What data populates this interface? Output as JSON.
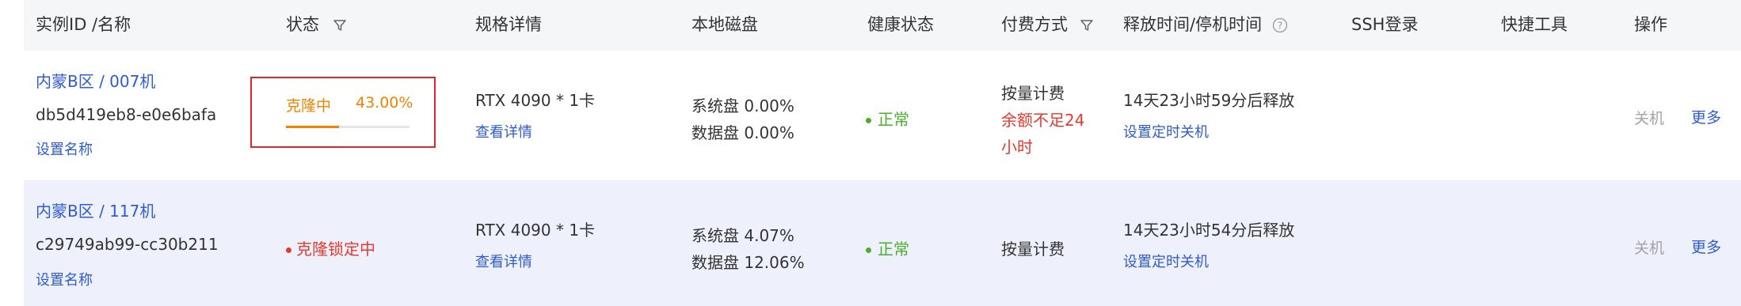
{
  "headers": {
    "instance": "实例ID /名称",
    "status": "状态",
    "spec": "规格详情",
    "disk": "本地磁盘",
    "health": "健康状态",
    "billing": "付费方式",
    "release": "释放时间/停机时间",
    "ssh": "SSH登录",
    "tools": "快捷工具",
    "actions": "操作"
  },
  "rows": [
    {
      "name": "内蒙B区 / 007机",
      "id": "db5d419eb8-e0e6bafa",
      "set_name": "设置名称",
      "status_label": "克隆中",
      "progress_text": "43.00%",
      "progress": 0.43,
      "spec": "RTX 4090 * 1卡",
      "spec_link": "查看详情",
      "sys_disk": "系统盘 0.00%",
      "data_disk": "数据盘 0.00%",
      "health": "正常",
      "billing": "按量计费",
      "billing_warn_1": "余额不足24",
      "billing_warn_2": "小时",
      "release": "14天23小时59分后释放",
      "release_link": "设置定时关机",
      "shutdown": "关机",
      "more": "更多"
    },
    {
      "name": "内蒙B区 / 117机",
      "id": "c29749ab99-cc30b211",
      "set_name": "设置名称",
      "status_label": "克隆锁定中",
      "spec": "RTX 4090 * 1卡",
      "spec_link": "查看详情",
      "sys_disk": "系统盘 4.07%",
      "data_disk": "数据盘 12.06%",
      "health": "正常",
      "billing": "按量计费",
      "release": "14天23小时54分后释放",
      "release_link": "设置定时关机",
      "shutdown": "关机",
      "more": "更多"
    }
  ],
  "colors": {
    "link": "#2f5bd6",
    "progress": "#f08400",
    "highlight_box": "#e0262a",
    "healthy": "#4caf2c",
    "warning": "#e8392f",
    "row_selected": "#eef1fb"
  },
  "icons": {
    "status_filter": "filter-icon",
    "billing_filter": "filter-icon",
    "release_help": "question-circle-icon"
  }
}
